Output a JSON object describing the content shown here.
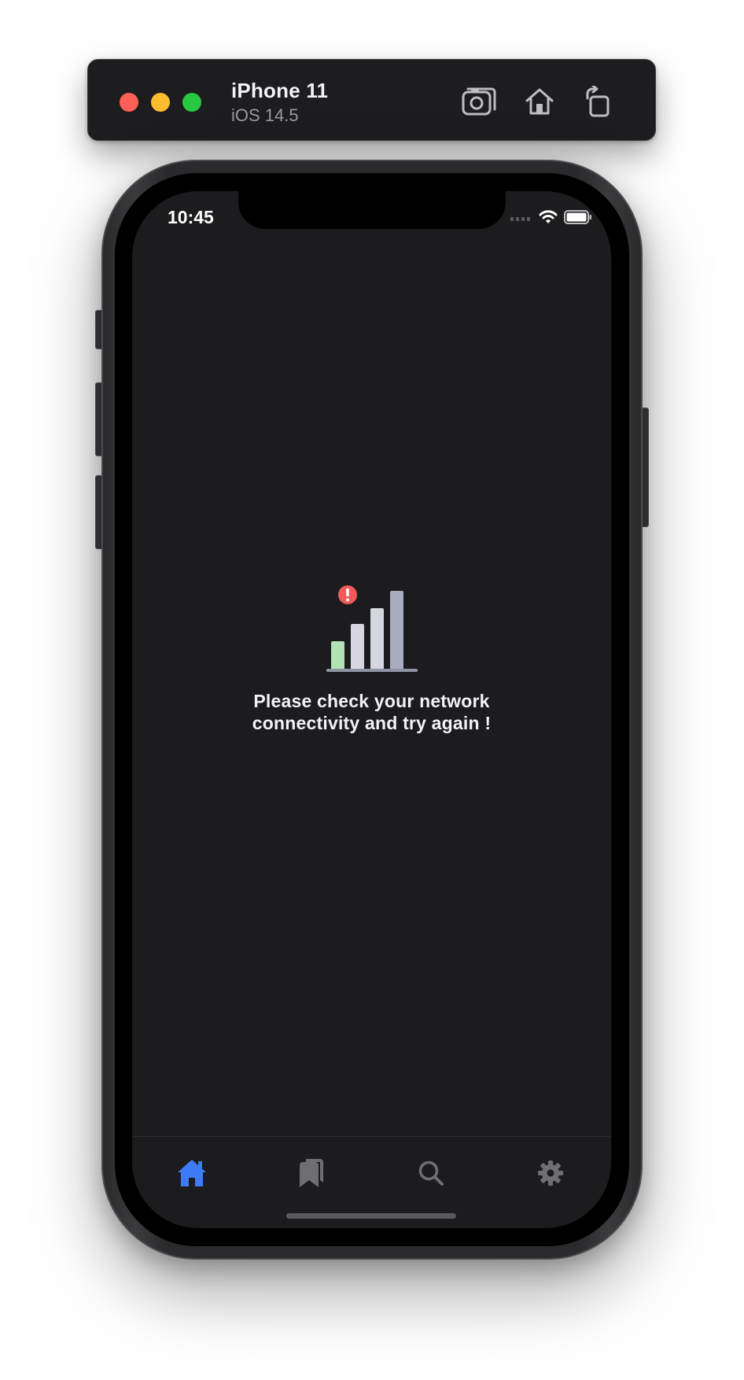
{
  "simulator": {
    "device_name": "iPhone 11",
    "os_version": "iOS 14.5",
    "toolbar_icons": [
      "camera-screenshot-icon",
      "home-icon",
      "rotate-icon"
    ]
  },
  "status_bar": {
    "time": "10:45",
    "icons": [
      "signal-icon",
      "wifi-icon",
      "battery-icon"
    ]
  },
  "offline_state": {
    "illustration": "no-signal-illustration",
    "message_line1": "Please check your network",
    "message_line2": "connectivity and try again !",
    "colors": {
      "alert": "#f25a5a",
      "bar_low": "#b2e3b4",
      "bar": "#d5d6e0",
      "bar_dark": "#a9adbf"
    }
  },
  "tab_bar": {
    "active_color": "#3d7bf7",
    "inactive_color": "#6e6e73",
    "tabs": [
      {
        "icon": "home-icon",
        "active": true
      },
      {
        "icon": "bookmarks-icon",
        "active": false
      },
      {
        "icon": "search-icon",
        "active": false
      },
      {
        "icon": "gear-icon",
        "active": false
      }
    ]
  }
}
